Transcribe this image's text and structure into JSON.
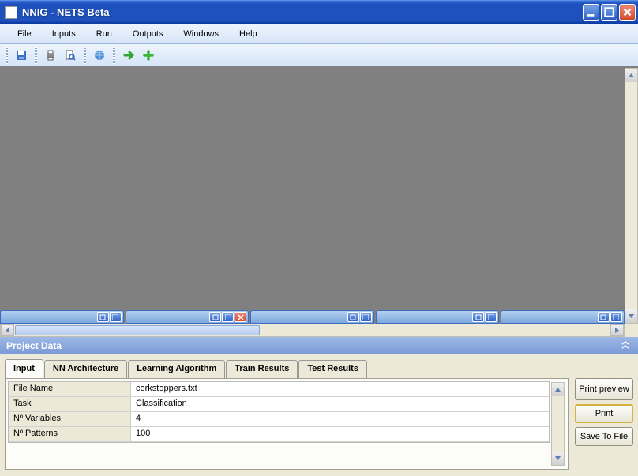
{
  "window": {
    "title": "NNIG - NETS Beta"
  },
  "menu": {
    "items": [
      "File",
      "Inputs",
      "Run",
      "Outputs",
      "Windows",
      "Help"
    ]
  },
  "toolbar": {
    "icons": [
      "save-icon",
      "print-icon",
      "print-preview-icon",
      "globe-icon",
      "go-icon",
      "add-icon"
    ]
  },
  "mdi": {
    "minimized": [
      {
        "label": "",
        "active": false
      },
      {
        "label": "",
        "active": true
      },
      {
        "label": "",
        "active": false
      },
      {
        "label": "",
        "active": false
      },
      {
        "label": "",
        "active": false
      }
    ]
  },
  "panel": {
    "title": "Project Data",
    "tabs": [
      "Input",
      "NN Architecture",
      "Learning Algorithm",
      "Train Results",
      "Test Results"
    ],
    "active_tab": "Input",
    "rows": [
      {
        "label": "File Name",
        "value": "corkstoppers.txt"
      },
      {
        "label": "Task",
        "value": "Classification"
      },
      {
        "label": "Nº Variables",
        "value": "4"
      },
      {
        "label": "Nº Patterns",
        "value": "100"
      }
    ],
    "buttons": {
      "print_preview": "Print preview",
      "print": "Print",
      "save_to_file": "Save To File"
    }
  }
}
